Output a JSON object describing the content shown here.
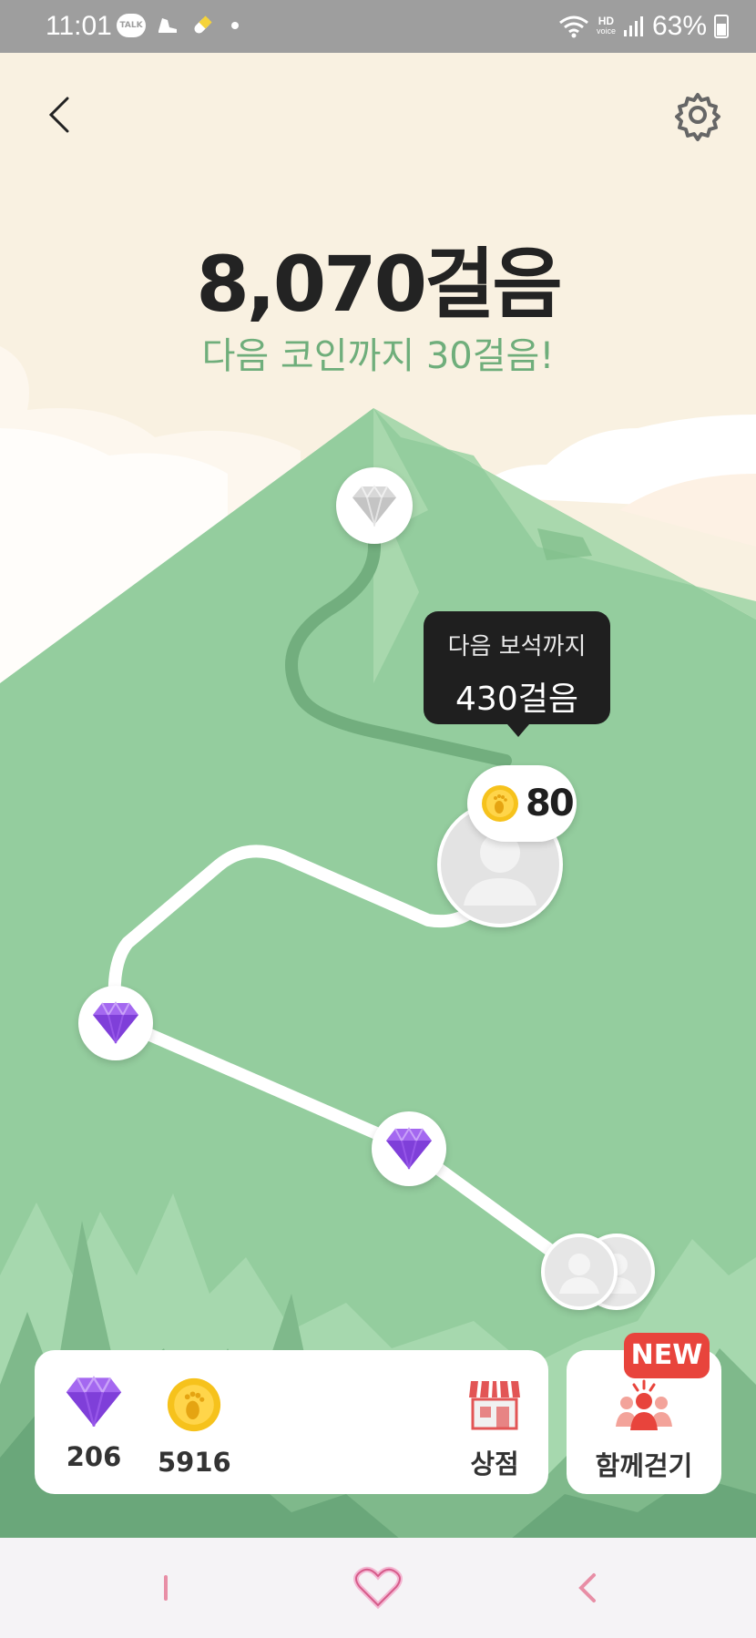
{
  "status_bar": {
    "time": "11:01",
    "talk_label": "TALK",
    "hd_label": "HD",
    "voice_label": "voice",
    "battery": "63%"
  },
  "header": {
    "back_icon": "chevron-left-icon",
    "settings_icon": "gear-icon"
  },
  "steps": {
    "total": "8,070걸음",
    "next_coin_message": "다음 코인까지 30걸음!"
  },
  "tooltip": {
    "line1": "다음 보석까지",
    "line2": "430걸음"
  },
  "coin_bubble": {
    "value": "80",
    "icon": "footprint-coin-icon"
  },
  "path_nodes": [
    {
      "type": "gem-gray",
      "icon": "gem-icon"
    },
    {
      "type": "avatar-current",
      "icon": "avatar-icon"
    },
    {
      "type": "gem-purple",
      "icon": "gem-icon"
    },
    {
      "type": "gem-purple",
      "icon": "gem-icon"
    },
    {
      "type": "avatar-group",
      "icon": "avatar-icon"
    }
  ],
  "inventory": {
    "gems": "206",
    "coins": "5916",
    "shop_label": "상점"
  },
  "walk_together": {
    "label": "함께걷기",
    "badge": "NEW"
  },
  "colors": {
    "background": "#f9f1e1",
    "mountain": "#94cd9e",
    "subtitle": "#6fae7b",
    "gem": "#9b5de5",
    "badge": "#e8443c"
  }
}
